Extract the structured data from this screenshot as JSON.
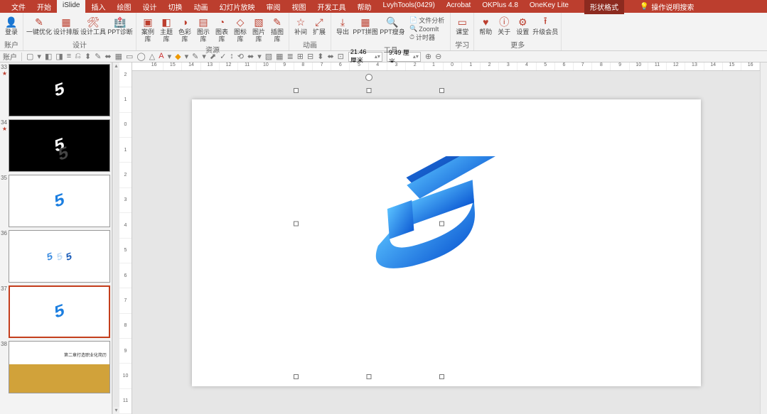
{
  "menu": {
    "tabs": [
      "文件",
      "开始",
      "iSlide",
      "插入",
      "绘图",
      "设计",
      "切换",
      "动画",
      "幻灯片放映",
      "审阅",
      "视图",
      "开发工具",
      "帮助",
      "LvyhTools(0429)",
      "Acrobat",
      "OKPlus 4.8",
      "OneKey Lite"
    ],
    "extra": "形状格式",
    "search": "操作说明搜索"
  },
  "ribbon": {
    "groups": [
      {
        "label": "账户",
        "items": [
          {
            "ico": "👤",
            "lbl": "登录"
          }
        ]
      },
      {
        "label": "设计",
        "items": [
          {
            "ico": "✎",
            "lbl": "一键优化"
          },
          {
            "ico": "▦",
            "lbl": "设计排版"
          },
          {
            "ico": "🛠",
            "lbl": "设计工具"
          },
          {
            "ico": "🏥",
            "lbl": "PPT诊断"
          }
        ]
      },
      {
        "label": "资源",
        "items": [
          {
            "ico": "▣",
            "lbl": "案例库"
          },
          {
            "ico": "◧",
            "lbl": "主题库"
          },
          {
            "ico": "◑",
            "lbl": "色彩库"
          },
          {
            "ico": "▤",
            "lbl": "图示库"
          },
          {
            "ico": "◔",
            "lbl": "图表库"
          },
          {
            "ico": "◇",
            "lbl": "图标库"
          },
          {
            "ico": "▧",
            "lbl": "图片库"
          },
          {
            "ico": "✎",
            "lbl": "插图库"
          }
        ]
      },
      {
        "label": "动画",
        "items": [
          {
            "ico": "☆",
            "lbl": "补间"
          },
          {
            "ico": "⤢",
            "lbl": "扩展"
          }
        ]
      },
      {
        "label": "工具",
        "items": [
          {
            "ico": "⤓",
            "lbl": "导出"
          },
          {
            "ico": "▦",
            "lbl": "PPT拼图"
          },
          {
            "ico": "🔍",
            "lbl": "PPT瘦身"
          }
        ],
        "side": [
          {
            "ico": "📄",
            "lbl": "文件分析"
          },
          {
            "ico": "🔍",
            "lbl": "ZoomIt"
          },
          {
            "ico": "⏱",
            "lbl": "计时器"
          }
        ]
      },
      {
        "label": "学习",
        "items": [
          {
            "ico": "▭",
            "lbl": "课堂"
          }
        ]
      },
      {
        "label": "更多",
        "items": [
          {
            "ico": "♥",
            "lbl": "帮助"
          },
          {
            "ico": "ⓘ",
            "lbl": "关于"
          },
          {
            "ico": "⚙",
            "lbl": "设置"
          },
          {
            "ico": "⭱",
            "lbl": "升级会员"
          }
        ]
      }
    ]
  },
  "qat": {
    "label": "账户",
    "width": "21.46 厘米",
    "height": "9.49 厘米"
  },
  "slides": [
    {
      "num": "33",
      "star": "★",
      "type": "dark-white"
    },
    {
      "num": "34",
      "star": "★",
      "type": "dark-shadow"
    },
    {
      "num": "35",
      "star": "",
      "type": "blue-single"
    },
    {
      "num": "36",
      "star": "",
      "type": "blue-multi"
    },
    {
      "num": "37",
      "star": "",
      "type": "blue-single",
      "current": true
    },
    {
      "num": "38",
      "star": "",
      "type": "content",
      "text": "第二章打造职业化简历"
    }
  ],
  "ruler_h": [
    "16",
    "15",
    "14",
    "13",
    "12",
    "11",
    "10",
    "9",
    "8",
    "7",
    "6",
    "5",
    "4",
    "3",
    "2",
    "1",
    "0",
    "1",
    "2",
    "3",
    "4",
    "5",
    "6",
    "7",
    "8",
    "9",
    "10",
    "11",
    "12",
    "13",
    "14",
    "15",
    "16"
  ],
  "ruler_v": [
    "2",
    "1",
    "0",
    "1",
    "2",
    "3",
    "4",
    "5",
    "6",
    "7",
    "8",
    "9",
    "10",
    "11"
  ]
}
